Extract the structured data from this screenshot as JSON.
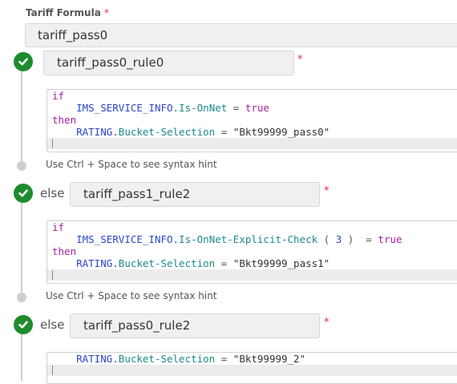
{
  "label": {
    "text": "Tariff Formula",
    "required": "*"
  },
  "formula_value": "tariff_pass0",
  "rules": [
    {
      "prefix": "",
      "name": "tariff_pass0_rule0",
      "required": "*",
      "code": [
        [
          {
            "t": "kw",
            "v": "if"
          }
        ],
        [
          {
            "t": "op",
            "v": "    "
          },
          {
            "t": "obj",
            "v": "IMS_SERVICE_INFO"
          },
          {
            "t": "op",
            "v": "."
          },
          {
            "t": "prop",
            "v": "Is-OnNet"
          },
          {
            "t": "op",
            "v": " = "
          },
          {
            "t": "kw",
            "v": "true"
          }
        ],
        [
          {
            "t": "kw",
            "v": "then"
          }
        ],
        [
          {
            "t": "op",
            "v": "    "
          },
          {
            "t": "obj",
            "v": "RATING"
          },
          {
            "t": "op",
            "v": "."
          },
          {
            "t": "prop",
            "v": "Bucket-Selection"
          },
          {
            "t": "op",
            "v": " = "
          },
          {
            "t": "str",
            "v": "\"Bkt99999_pass0\""
          }
        ]
      ],
      "hint": "Use Ctrl + Space to see syntax hint"
    },
    {
      "prefix": "else",
      "name": "tariff_pass1_rule2",
      "required": "*",
      "code": [
        [
          {
            "t": "kw",
            "v": "if"
          }
        ],
        [
          {
            "t": "op",
            "v": "    "
          },
          {
            "t": "obj",
            "v": "IMS_SERVICE_INFO"
          },
          {
            "t": "op",
            "v": "."
          },
          {
            "t": "prop",
            "v": "Is-OnNet-Explicit-Check"
          },
          {
            "t": "op",
            "v": " ( "
          },
          {
            "t": "num",
            "v": "3"
          },
          {
            "t": "op",
            "v": " )  = "
          },
          {
            "t": "kw",
            "v": "true"
          }
        ],
        [
          {
            "t": "kw",
            "v": "then"
          }
        ],
        [
          {
            "t": "op",
            "v": "    "
          },
          {
            "t": "obj",
            "v": "RATING"
          },
          {
            "t": "op",
            "v": "."
          },
          {
            "t": "prop",
            "v": "Bucket-Selection"
          },
          {
            "t": "op",
            "v": " = "
          },
          {
            "t": "str",
            "v": "\"Bkt99999_pass1\""
          }
        ]
      ],
      "hint": "Use Ctrl + Space to see syntax hint"
    },
    {
      "prefix": "else",
      "name": "tariff_pass0_rule2",
      "required": "*",
      "code": [
        [
          {
            "t": "op",
            "v": "    "
          },
          {
            "t": "obj",
            "v": "RATING"
          },
          {
            "t": "op",
            "v": "."
          },
          {
            "t": "prop",
            "v": "Bucket-Selection"
          },
          {
            "t": "op",
            "v": " = "
          },
          {
            "t": "str",
            "v": "\"Bkt99999_2\""
          }
        ]
      ],
      "hint": ""
    }
  ],
  "colors": {
    "check": "#1e8c2e",
    "keyword": "#a31fa3",
    "object": "#2b47c9",
    "property": "#1c8a8a",
    "required": "#e0245e"
  },
  "icons": {
    "rule_status": "check-circle-icon",
    "timeline_end": "timeline-dot-icon"
  }
}
